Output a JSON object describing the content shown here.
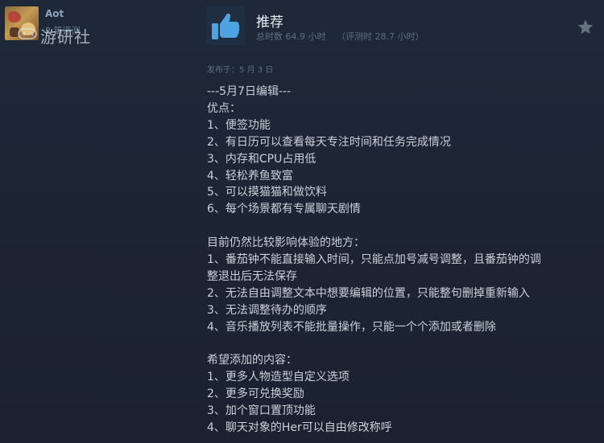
{
  "reviewer": {
    "name": "Aot",
    "meta": "2 篇评测"
  },
  "watermark": {
    "text": "游研社"
  },
  "review": {
    "verdict": "推荐",
    "total_hours": "总时数 64.9 小时",
    "hours_at_review": "（评测时 28.7 小时）",
    "posted": "发布于：5 月 3 日",
    "lines": [
      "---5月7日编辑---",
      "优点：",
      "1、便签功能",
      "2、有日历可以查看每天专注时间和任务完成情况",
      "3、内存和CPU占用低",
      "4、轻松养鱼致富",
      "5、可以摸猫猫和做饮料",
      "6、每个场景都有专属聊天剧情",
      "",
      "目前仍然比较影响体验的地方：",
      "1、番茄钟不能直接输入时间，只能点加号减号调整，且番茄钟的调",
      "整退出后无法保存",
      "2、无法自由调整文本中想要编辑的位置，只能整句删掉重新输入",
      "3、无法调整待办的顺序",
      "4、音乐播放列表不能批量操作，只能一个个添加或者删除",
      "",
      "希望添加的内容：",
      "1、更多人物造型自定义选项",
      "2、更多可兑换奖励",
      "3、加个窗口置顶功能",
      "4、聊天对象的Her可以自由修改称呼"
    ]
  },
  "icons": {
    "thumb": "thumbs-up-icon",
    "star": "star-icon",
    "gamepad": "gamepad-icon"
  },
  "colors": {
    "background": "#1b2433",
    "thumb_blue": "#4fa3e0",
    "text": "#c8d0d8",
    "muted": "#5d6f80"
  }
}
